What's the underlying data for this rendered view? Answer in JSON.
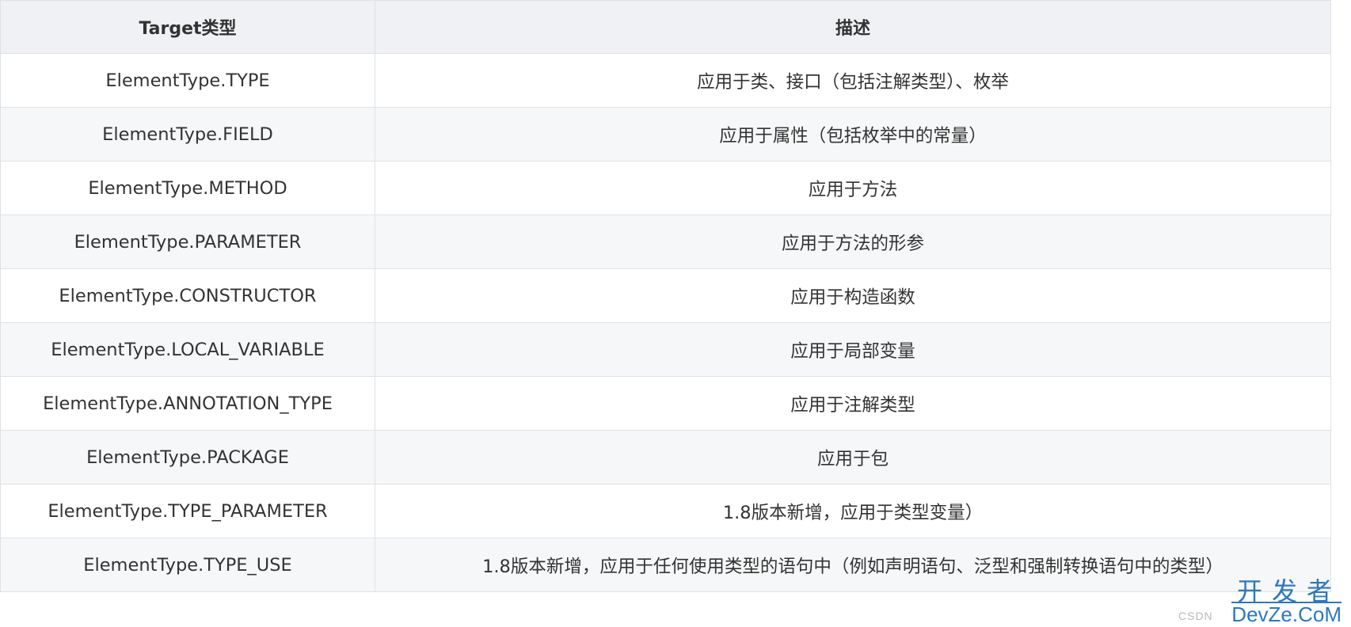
{
  "table": {
    "headers": [
      "Target类型",
      "描述"
    ],
    "rows": [
      [
        "ElementType.TYPE",
        "应用于类、接口（包括注解类型）、枚举"
      ],
      [
        "ElementType.FIELD",
        "应用于属性（包括枚举中的常量）"
      ],
      [
        "ElementType.METHOD",
        "应用于方法"
      ],
      [
        "ElementType.PARAMETER",
        "应用于方法的形参"
      ],
      [
        "ElementType.CONSTRUCTOR",
        "应用于构造函数"
      ],
      [
        "ElementType.LOCAL_VARIABLE",
        "应用于局部变量"
      ],
      [
        "ElementType.ANNOTATION_TYPE",
        "应用于注解类型"
      ],
      [
        "ElementType.PACKAGE",
        "应用于包"
      ],
      [
        "ElementType.TYPE_PARAMETER",
        "1.8版本新增，应用于类型变量）"
      ],
      [
        "ElementType.TYPE_USE",
        "1.8版本新增，应用于任何使用类型的语句中（例如声明语句、泛型和强制转换语句中的类型）"
      ]
    ]
  },
  "watermark": {
    "csdn": "CSDN",
    "top": "开发者",
    "bottom": "DevZe.CoM",
    "color": "#2b78c2"
  },
  "colors": {
    "header_bg": "#eff1f4",
    "stripe_bg": "#f6f7f8",
    "border": "#dfe2e5",
    "text": "#333333"
  }
}
